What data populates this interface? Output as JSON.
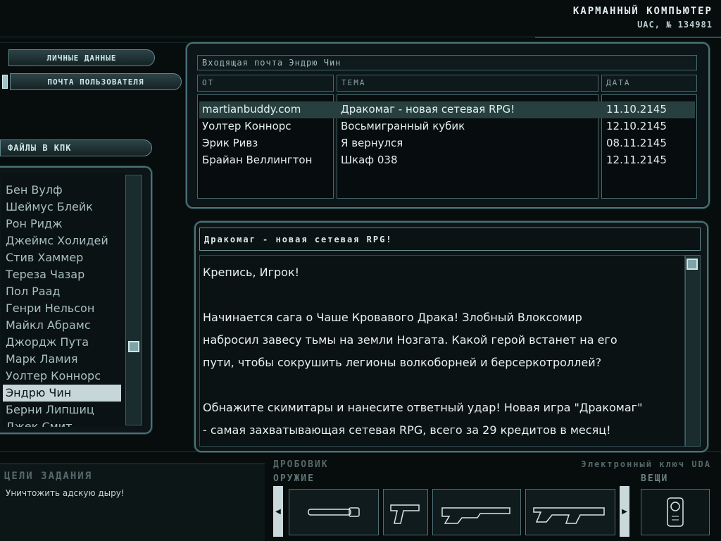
{
  "header": {
    "title": "КАРМАННЫЙ КОМПЬЮТЕР",
    "subtitle": "UAC, № 134981"
  },
  "nav": {
    "personal": "ЛИЧНЫЕ ДАННЫЕ",
    "mail": "ПОЧТА ПОЛЬЗОВАТЕЛЯ"
  },
  "files": {
    "title": "ФАЙЛЫ В КПК",
    "items": [
      "Бен Вулф",
      "Шеймус Блейк",
      "Рон Ридж",
      "Джеймс Холидей",
      "Стив Хаммер",
      "Тереза Чазар",
      "Пол Раад",
      "Генри Нельсон",
      "Майкл Абрамс",
      "Джордж Пута",
      "Марк Ламия",
      "Уолтер Коннорс",
      "Эндрю Чин",
      "Берни Липшиц",
      "Джек Смит"
    ]
  },
  "inbox": {
    "title": "Входящая почта  Эндрю Чин",
    "col_from": "ОТ",
    "col_subject": "ТЕМА",
    "col_date": "ДАТА",
    "rows": [
      {
        "from": "martianbuddy.com",
        "subject": "Дракомаг - новая сетевая RPG!",
        "date": "11.10.2145"
      },
      {
        "from": "Уолтер Коннорс",
        "subject": "Восьмигранный кубик",
        "date": "12.10.2145"
      },
      {
        "from": "Эрик Ривз",
        "subject": "Я вернулся",
        "date": "08.11.2145"
      },
      {
        "from": "Брайан Веллингтон",
        "subject": "Шкаф 038",
        "date": "12.11.2145"
      }
    ]
  },
  "message": {
    "title": "Дракомаг - новая сетевая RPG!",
    "lines": [
      "Крепись, Игрок!",
      "",
      "Начинается сага о Чаше Кровавого Драка!  Злобный Влоксомир",
      "набросил завесу тьмы на земли Нозгата. Какой герой встанет на его",
      "пути, чтобы сокрушить легионы волкоборней и берсеркотроллей?",
      "",
      "Обнажите скимитары и нанесите ответный удар! Новая игра \"Дракомаг\"",
      "- самая захватывающая сетевая RPG, всего за 29 кредитов в месяц!"
    ]
  },
  "objectives": {
    "title": "ЦЕЛИ ЗАДАНИЯ",
    "text": "Уничтожить адскую дыру!"
  },
  "weapons": {
    "current": "ДРОБОВИК",
    "label": "ОРУЖИЕ"
  },
  "items": {
    "current": "Электронный ключ UDA",
    "label": "ВЕЩИ"
  },
  "colors": {
    "accent": "#4a7277",
    "selected_row": "#27403f",
    "text": "#e3eef0"
  }
}
